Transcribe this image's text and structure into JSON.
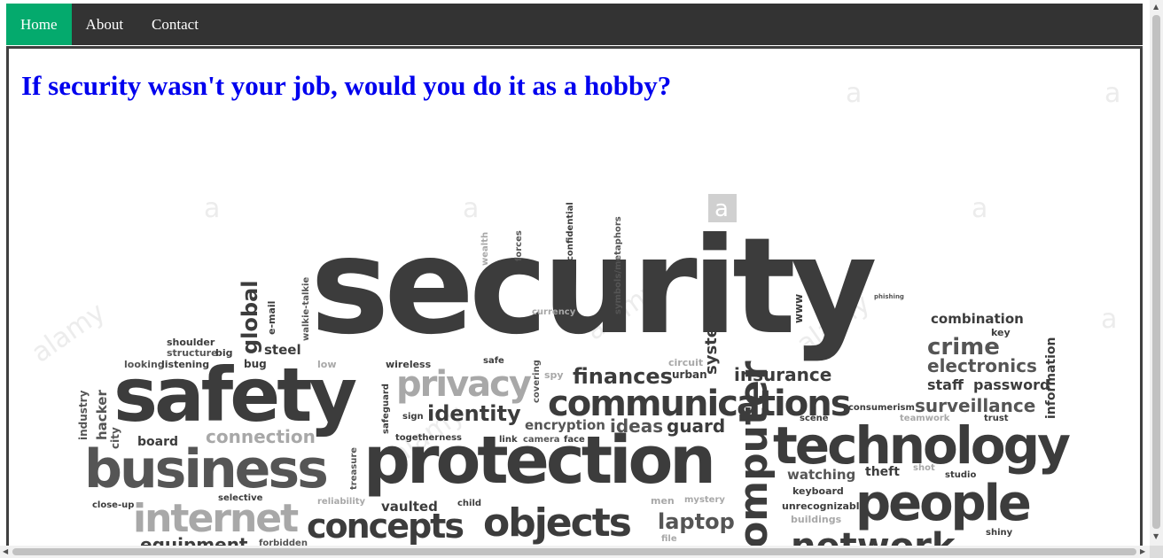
{
  "nav": {
    "items": [
      {
        "label": "Home",
        "active": true
      },
      {
        "label": "About",
        "active": false
      },
      {
        "label": "Contact",
        "active": false
      }
    ]
  },
  "main": {
    "headline": "If security wasn't your job, would you do it as a hobby?"
  },
  "wordcloud": {
    "watermark": "alamy",
    "words": [
      "security",
      "safety",
      "protection",
      "business",
      "technology",
      "communications",
      "people",
      "privacy",
      "internet",
      "concepts",
      "objects",
      "identity",
      "finances",
      "insurance",
      "computer",
      "network",
      "crime",
      "electronics",
      "surveillance",
      "combination",
      "key",
      "staff",
      "password",
      "information",
      "connection",
      "board",
      "hacker",
      "industry",
      "city",
      "global",
      "steel",
      "e-mail",
      "walkie-talkie",
      "wealth",
      "forces",
      "confidential",
      "symbols/metaphors",
      "currency",
      "www",
      "system",
      "urban",
      "circuit",
      "spy",
      "covering",
      "safe",
      "wireless",
      "low",
      "bug",
      "shoulder",
      "structure",
      "big",
      "looking",
      "listening",
      "ideas",
      "guard",
      "encryption",
      "camera",
      "face",
      "link",
      "sign",
      "safeguard",
      "togetherness",
      "watching",
      "theft",
      "shot",
      "studio",
      "keyboard",
      "unrecognizable",
      "buildings",
      "consumerism",
      "teamwork",
      "trust",
      "scene",
      "laptop",
      "mystery",
      "men",
      "file",
      "equipment",
      "forbidden",
      "selective",
      "reliability",
      "vaulted",
      "child",
      "close-up",
      "treasure",
      "shiny",
      "phishing"
    ]
  },
  "colors": {
    "navbar": "#333333",
    "nav_active": "#04aa6d",
    "headline": "#0000ee",
    "cloud_dark": "#3c3c3c",
    "cloud_mid": "#6e6e6e",
    "cloud_light": "#a8a8a8"
  },
  "icons": {
    "scroll_up": "triangle-up",
    "scroll_down": "triangle-down",
    "scroll_left": "triangle-left",
    "scroll_right": "triangle-right"
  }
}
